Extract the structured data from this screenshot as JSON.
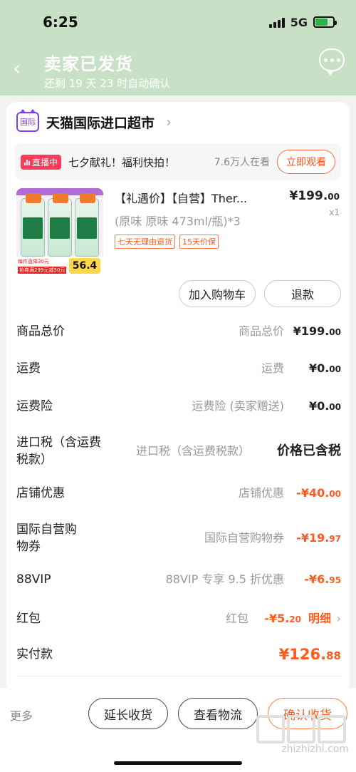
{
  "status": {
    "time": "6:25",
    "network": "5G"
  },
  "header": {
    "title": "卖家已发货",
    "subtitle": "还剩 19 天 23 时自动确认"
  },
  "shop": {
    "badge": "国际",
    "name": "天猫国际进口超市"
  },
  "live": {
    "badge": "直播中",
    "text": "七夕献礼！福利快拍！",
    "count": "7.6万人在看",
    "watch_label": "立即观看"
  },
  "product": {
    "title": "【礼遇价】【自营】Ther...",
    "price_main": "¥199.",
    "price_cents": "00",
    "spec": "(原味 原味 473ml/瓶)*3",
    "qty": "x1",
    "tags": [
      "七天无理由退货",
      "15天价保"
    ],
    "img_price": "56.4",
    "img_left": "每件直降30元",
    "img_ticket": "抢券满299元减30元"
  },
  "actions": {
    "add_cart": "加入购物车",
    "refund": "退款"
  },
  "rows": [
    {
      "label": "商品总价",
      "mid": "商品总价",
      "value": "¥199.",
      "cents": "00",
      "color": "normal"
    },
    {
      "label": "运费",
      "mid": "运费",
      "value": "¥0.",
      "cents": "00",
      "color": "normal"
    },
    {
      "label": "运费险",
      "mid": "运费险 (卖家赠送)",
      "value": "¥0.",
      "cents": "00",
      "color": "normal"
    },
    {
      "label": "进口税（含运费税款）",
      "mid": "进口税（含运费税款）",
      "value": "价格已含税",
      "cents": "",
      "color": "normal"
    },
    {
      "label": "店铺优惠",
      "mid": "店铺优惠",
      "value": "-¥40.",
      "cents": "00",
      "color": "orange"
    },
    {
      "label": "国际自营购物券",
      "mid": "国际自营购物券",
      "value": "-¥19.",
      "cents": "97",
      "color": "orange"
    },
    {
      "label": "88VIP",
      "mid": "88VIP 专享 9.5 折优惠",
      "value": "-¥6.",
      "cents": "95",
      "color": "orange"
    },
    {
      "label": "红包",
      "mid": "红包",
      "value": "-¥5.",
      "cents": "20",
      "detail": "明细",
      "color": "orange"
    },
    {
      "label": "实付款",
      "mid": "",
      "value": "¥126.",
      "cents": "88",
      "color": "orange"
    }
  ],
  "bottom": {
    "more": "更多",
    "extend": "延长收货",
    "logistics": "查看物流",
    "confirm": "确认收货"
  },
  "watermark": "zhizhizhi.com"
}
